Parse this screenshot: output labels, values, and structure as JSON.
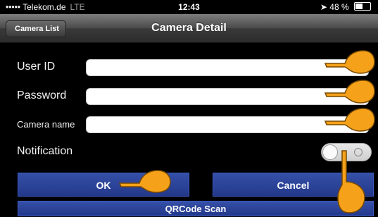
{
  "status_bar": {
    "carrier": "••••• Telekom.de",
    "network": "LTE",
    "time": "12:43",
    "battery": "48 %",
    "battery_level": 0.48,
    "icons": [
      "signal-icon",
      "location-icon",
      "battery-icon"
    ]
  },
  "nav": {
    "back_label": "Camera List",
    "title": "Camera Detail"
  },
  "form": {
    "user_id": {
      "label": "User ID",
      "value": ""
    },
    "password": {
      "label": "Password",
      "value": ""
    },
    "camera_name": {
      "label": "Camera name",
      "value": ""
    },
    "notification": {
      "label": "Notification",
      "on": false
    }
  },
  "buttons": {
    "ok": "OK",
    "cancel": "Cancel",
    "qrcode": "QRCode Scan"
  },
  "colors": {
    "button_blue": "#23388a",
    "hand": "#f5a21a"
  },
  "icons": [
    "pointing-hand-icon"
  ]
}
